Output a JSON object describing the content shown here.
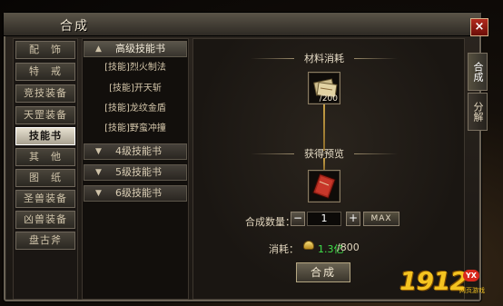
{
  "window": {
    "title": "合成",
    "close_label": "×"
  },
  "side_tabs": [
    {
      "label": "合成",
      "active": true
    },
    {
      "label": "分解",
      "active": false
    }
  ],
  "categories": [
    {
      "label": "配　饰",
      "active": false
    },
    {
      "label": "特　戒",
      "active": false
    },
    {
      "label": "竞技装备",
      "active": false
    },
    {
      "label": "天罡装备",
      "active": false
    },
    {
      "label": "技能书",
      "active": true
    },
    {
      "label": "其　他",
      "active": false
    },
    {
      "label": "图　纸",
      "active": false
    },
    {
      "label": "圣兽装备",
      "active": false
    },
    {
      "label": "凶兽装备",
      "active": false
    },
    {
      "label": "盘古斧",
      "active": false
    }
  ],
  "skill_groups": [
    {
      "label": "高级技能书",
      "open": true,
      "arrow": "▲",
      "items": [
        "[技能]烈火制法",
        "[技能]开天斩",
        "[技能]龙纹金盾",
        "[技能]野蛮冲撞"
      ]
    },
    {
      "label": "4级技能书",
      "open": false,
      "arrow": "▼",
      "items": []
    },
    {
      "label": "5级技能书",
      "open": false,
      "arrow": "▼",
      "items": []
    },
    {
      "label": "6级技能书",
      "open": false,
      "arrow": "▼",
      "items": []
    }
  ],
  "materials": {
    "label": "材料消耗",
    "item_icon": "skill-scroll-icon",
    "count": "/200"
  },
  "preview": {
    "label": "获得预览",
    "item_icon": "red-skill-book-icon"
  },
  "quantity": {
    "label": "合成数量：",
    "minus": "−",
    "value": "1",
    "plus": "+",
    "max_label": "MAX"
  },
  "cost": {
    "label": "消耗：",
    "icon": "gold-ingot-icon",
    "have": "1.3亿",
    "need": "/800"
  },
  "craft_button": "合成",
  "watermark": {
    "number": "1912",
    "badge": "YX",
    "sub": "网页游戏"
  },
  "colors": {
    "accent_gold": "#c9a247",
    "cost_green": "#3fe04a",
    "close_red": "#b32a1e"
  }
}
